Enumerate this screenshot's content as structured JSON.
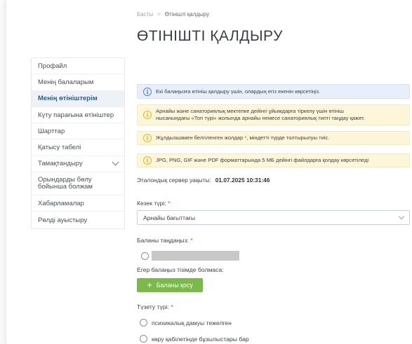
{
  "breadcrumb": {
    "home": "Басты",
    "separator": ">",
    "current": "Өтінішті қалдыру"
  },
  "page_title": "ӨТІНІШТІ ҚАЛДЫРУ",
  "sidebar": {
    "items": [
      {
        "label": "Профайл"
      },
      {
        "label": "Менің балаларым"
      },
      {
        "label": "Менің өтініштерім"
      },
      {
        "label": "Күту парағына өтініштер"
      },
      {
        "label": "Шарттар"
      },
      {
        "label": "Қатысу табелі"
      },
      {
        "label": "Тамақтандыру"
      },
      {
        "label": "Орындарды бөлу бойынша болжам"
      },
      {
        "label": "Хабарламалар"
      },
      {
        "label": "Рөлді ауыстыру"
      }
    ],
    "active_item": "Менің өтініштерім"
  },
  "alerts": {
    "twins": "Екі балаңызға өтініш қалдыру үшін, олардың егіз екенін көрсетіңіз.",
    "special_line1": "Арнайы және санаториялық мектепке дейінгі ұйымдарға тіркелу үшін өтініш",
    "special_line2": "нысанындағы «Топ түрі» жолында арнайы немесе санаториялық типті таңдау қажет.",
    "required_before": "Жұлдызшамен белгіленген жолдар ",
    "required_star": "*",
    "required_after": ", міндетті түрде толтырылуы тиіс.",
    "files": "JPG, PNG, GIF және PDF форматтарында 5 МБ дейінгі файлдарға қолдау көрсетіледі"
  },
  "server_time": {
    "label": "Эталондық сервер уақыты:",
    "value": "01.07.2025 10:31:46"
  },
  "queue_type": {
    "label": "Кезек түрі:",
    "required": "*",
    "selected": "Арнайы бағыттағы"
  },
  "child_select": {
    "label": "Баланы таңдаңыз:",
    "required": "*",
    "not_in_list": "Егер балаңыз тізімде болмаса:",
    "add_button": "Баланы қосу",
    "add_icon": "+"
  },
  "correction_type": {
    "label": "Түзету түрі:",
    "required": "*",
    "options": [
      "психикалық дамуы тежелген",
      "көру қабілетінде бұзылыстары бар"
    ]
  },
  "icons": {
    "info": "i"
  },
  "colors": {
    "accent_green": "#7ab94a",
    "info_blue": "#4a84d6",
    "warn_yellow": "#e6b423",
    "required_red": "#e0452b"
  }
}
